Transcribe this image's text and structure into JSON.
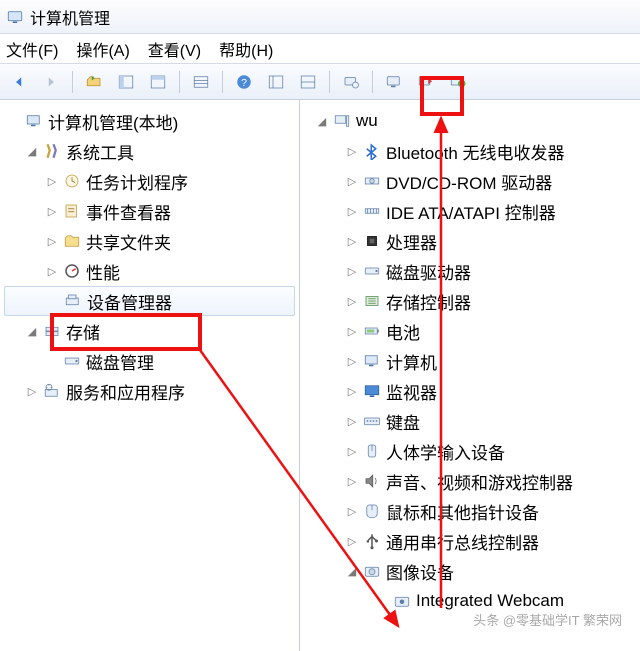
{
  "window": {
    "title": "计算机管理"
  },
  "menu": {
    "file": "文件(F)",
    "action": "操作(A)",
    "view": "查看(V)",
    "help": "帮助(H)"
  },
  "toolbar_icons": [
    "back",
    "forward",
    "up",
    "view-pane",
    "view-pane2",
    "list",
    "help",
    "prop1",
    "prop2",
    "device",
    "monitor",
    "scan",
    "enable"
  ],
  "left_tree": {
    "root": "计算机管理(本地)",
    "system_tools": "系统工具",
    "task_scheduler": "任务计划程序",
    "event_viewer": "事件查看器",
    "shared_folders": "共享文件夹",
    "performance": "性能",
    "device_manager": "设备管理器",
    "storage": "存储",
    "disk_mgmt": "磁盘管理",
    "services": "服务和应用程序"
  },
  "right_tree": {
    "root": "wu",
    "items": [
      "Bluetooth 无线电收发器",
      "DVD/CD-ROM 驱动器",
      "IDE ATA/ATAPI 控制器",
      "处理器",
      "磁盘驱动器",
      "存储控制器",
      "电池",
      "计算机",
      "监视器",
      "键盘",
      "人体学输入设备",
      "声音、视频和游戏控制器",
      "鼠标和其他指针设备",
      "通用串行总线控制器",
      "图像设备"
    ],
    "webcam": "Integrated Webcam"
  },
  "watermark": "头条 @零基础学IT  繁荣网"
}
